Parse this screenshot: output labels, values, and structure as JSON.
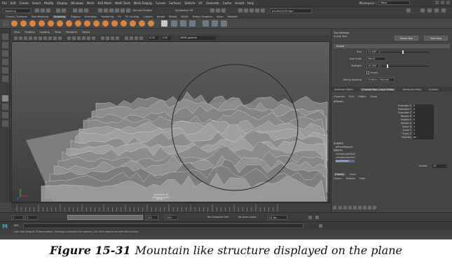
{
  "menubar": [
    "File",
    "Edit",
    "Create",
    "Select",
    "Modify",
    "Display",
    "Windows",
    "Mesh",
    "Edit Mesh",
    "Mesh Tools",
    "Mesh Display",
    "Curves",
    "Surfaces",
    "Deform",
    "UV",
    "Generate",
    "Cache",
    "Arnold",
    "Help"
  ],
  "workspace": {
    "label": "Workspace :",
    "value": "Maya"
  },
  "status": {
    "mode": "Modeling",
    "live_surface": "No Live Surface",
    "symmetry": "Symmetry: Off",
    "object_field": "pSurface1(Shape"
  },
  "shelf_tabs": [
    "Curves / Surfaces",
    "Poly Modeling",
    "Sculpting",
    "Rigging",
    "Animation",
    "Rendering",
    "FX",
    "FX Caching",
    "Custom",
    "Arnold",
    "Bifrost",
    "MASH",
    "Motion Graphics",
    "XGen",
    "Redshift"
  ],
  "shelf_active": 2,
  "panel_menu": [
    "View",
    "Shading",
    "Lighting",
    "Show",
    "Renderer",
    "Panels"
  ],
  "panel_tools": {
    "value1": "0.00",
    "value2": "1.00",
    "colorspace": "sRGB gamma"
  },
  "viewport": {
    "label": "Available on pPlaneShape1",
    "label2": "persp",
    "circle_color": "#222222",
    "plane_color": "#7d7d7d",
    "ridge_color": "#d8d8d8"
  },
  "tool_settings": {
    "title": "Tool Settings",
    "tool_name": "Sculpt Tool",
    "reset_label": "Reset Tool",
    "help_label": "Tool Help",
    "section": "Sculpt",
    "size_label": "Size",
    "size_value": "11.000",
    "mode_label": "Size Units",
    "mode_value": "World",
    "strength_label": "Strength",
    "strength_value": "15.000",
    "invert_label": "Invert",
    "stamp_label": "Stamp Spacing",
    "stamp_value": "Uniform / Normal"
  },
  "channel_box": {
    "tabs": [
      "Attribute Editor",
      "Channel Box / Layer Editor",
      "Attribute Editor",
      "Outliner"
    ],
    "active_tab": 1,
    "menu": [
      "Channels",
      "Edit",
      "Object",
      "Show"
    ],
    "object": "pPlane1",
    "attributes": [
      {
        "name": "Translate X",
        "value": "0"
      },
      {
        "name": "Translate Y",
        "value": "0"
      },
      {
        "name": "Translate Z",
        "value": "0"
      },
      {
        "name": "Rotate X",
        "value": "0"
      },
      {
        "name": "Rotate Y",
        "value": "0"
      },
      {
        "name": "Rotate Z",
        "value": "0"
      },
      {
        "name": "Scale X",
        "value": "1"
      },
      {
        "name": "Scale Y",
        "value": "1"
      },
      {
        "name": "Scale Z",
        "value": "1"
      },
      {
        "name": "Visibility",
        "value": "on"
      }
    ],
    "shapes_header": "SHAPES",
    "shapes": [
      "pPlaneShape1"
    ],
    "inputs_header": "INPUTS",
    "inputs": [
      "createColorSet1",
      "createColorSet1",
      "polyPlane1"
    ],
    "selected_input": 2,
    "subdiv_label": "Subdiv",
    "subdiv_value": "10"
  },
  "layers": {
    "tabs": [
      "Display",
      "Anim"
    ],
    "active_tab": 0,
    "menu": [
      "Layers",
      "Options",
      "Help"
    ]
  },
  "range": {
    "start": "1",
    "start2": "1",
    "end": "120",
    "end2": "200",
    "character_set": "No Character Set",
    "anim_layer": "No Anim Layer",
    "fps": "24 fps"
  },
  "cmd": {
    "logo": "M",
    "lang": "MEL"
  },
  "help_text": "Left click-drag to fill the surface. Holding b displays the volume; Ctrl click-drag to smooth the surface",
  "caption": {
    "number": "Figure 15-31",
    "text": "Mountain like structure displayed on the plane"
  }
}
